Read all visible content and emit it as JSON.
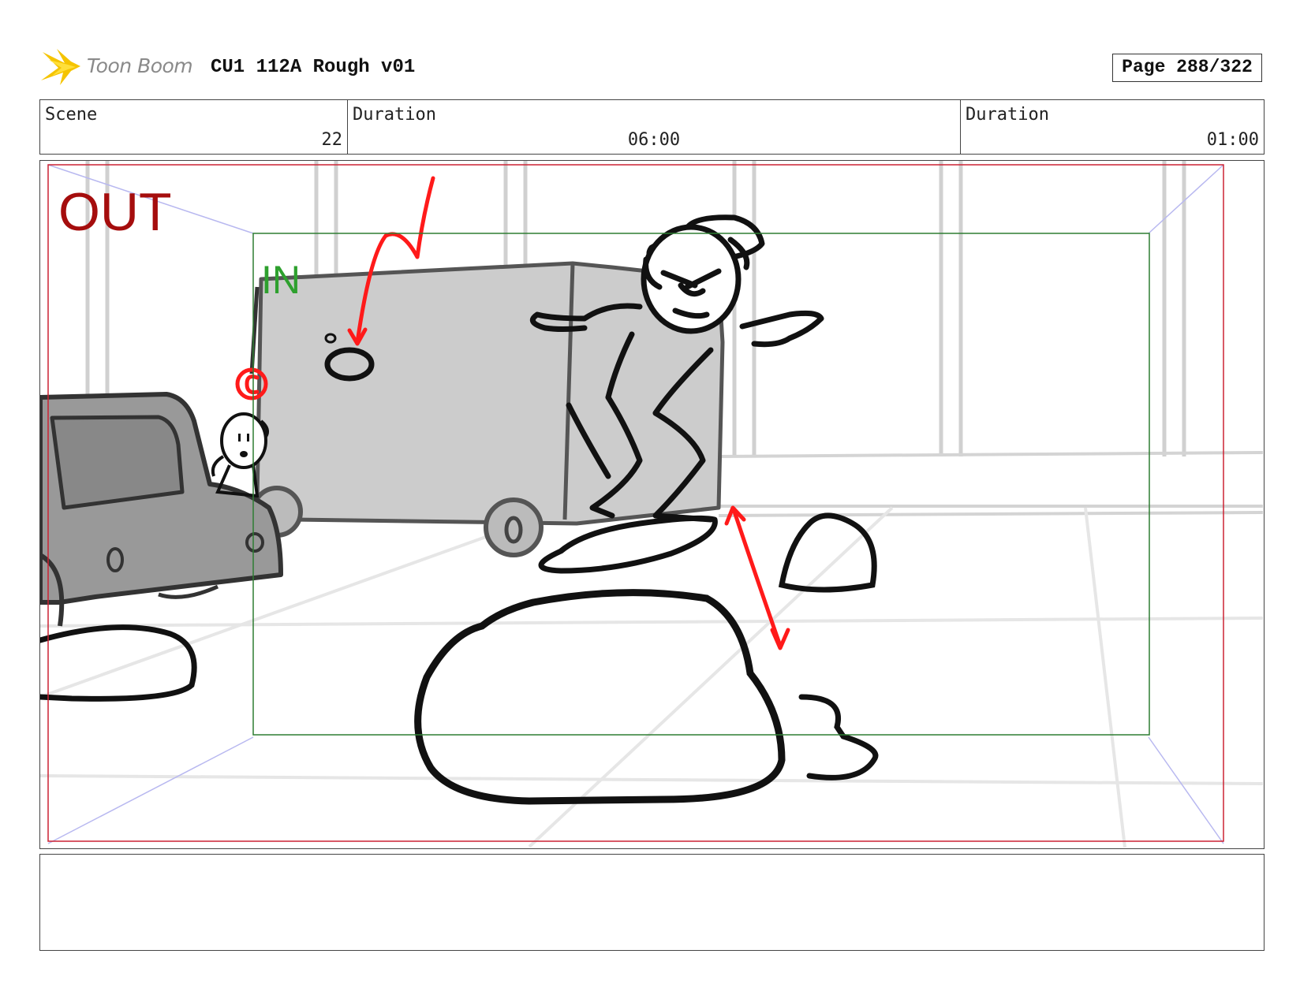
{
  "header": {
    "logo_text": "Toon Boom",
    "title": "CU1 112A Rough v01",
    "page_label": "Page 288/322"
  },
  "info": {
    "scene_label": "Scene",
    "scene_value": "22",
    "duration1_label": "Duration",
    "duration1_value": "06:00",
    "duration2_label": "Duration",
    "duration2_value": "01:00"
  },
  "panel": {
    "out_label": "OUT",
    "in_label": "IN",
    "out_frame_color": "#cc2233",
    "in_frame_color": "#2e7d32",
    "annotation_color": "#ff1a1a"
  },
  "notes": {
    "text": ""
  }
}
